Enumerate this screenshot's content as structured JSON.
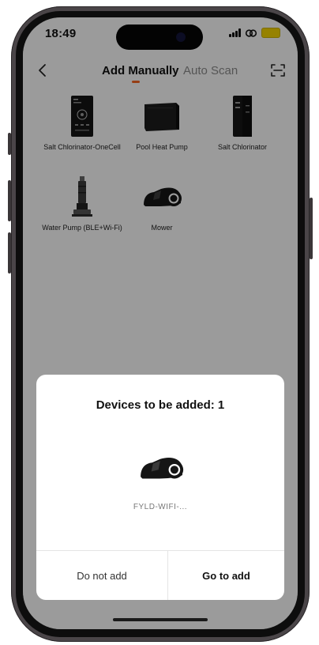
{
  "status_bar": {
    "time": "18:49"
  },
  "nav": {
    "tab_manual": "Add Manually",
    "tab_scan": "Auto Scan",
    "accent": "#f26522"
  },
  "devices": [
    {
      "label": "Salt Chlorinator-OneCell",
      "icon": "salt-chlorinator-onecell-icon"
    },
    {
      "label": "Pool Heat Pump",
      "icon": "pool-heat-pump-icon"
    },
    {
      "label": "Salt Chlorinator",
      "icon": "salt-chlorinator-icon"
    },
    {
      "label": "Water Pump (BLE+Wi-Fi)",
      "icon": "water-pump-icon"
    },
    {
      "label": "Mower",
      "icon": "mower-icon"
    }
  ],
  "dialog": {
    "title": "Devices to be added: 1",
    "device_name": "FYLD-WIFI-...",
    "cancel_label": "Do not add",
    "confirm_label": "Go to add"
  }
}
